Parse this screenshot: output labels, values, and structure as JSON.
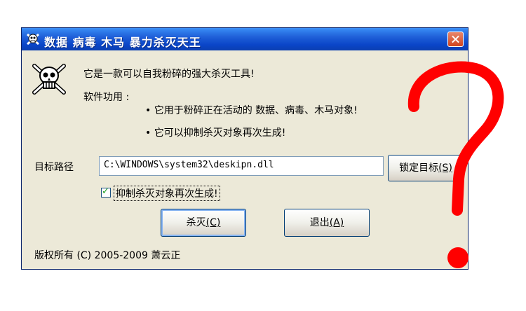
{
  "window": {
    "title": "数据 病毒 木马 暴力杀灭天王",
    "icon": "skull-icon"
  },
  "intro": {
    "headline": "它是一款可以自我粉碎的强大杀灭工具!",
    "features_label": "软件功用 :",
    "bullets": [
      "•  它用于粉碎正在活动的 数据、病毒、木马对象!",
      "•  它可以抑制杀灭对象再次生成!"
    ]
  },
  "target": {
    "label": "目标路径",
    "value": "C:\\WINDOWS\\system32\\deskipn.dll",
    "lock_button": {
      "text": "锁定目标",
      "key": "(S)"
    }
  },
  "suppress": {
    "checked": true,
    "label": "抑制杀灭对象再次生成!"
  },
  "actions": {
    "kill": {
      "text": "杀灭",
      "key": "(C)"
    },
    "exit": {
      "text": "退出",
      "key": "(A)"
    }
  },
  "footer": {
    "copyright": "版权所有 (C) 2005-2009 萧云正"
  },
  "colors": {
    "titlebar": "#0a45c8",
    "dialog_bg": "#ece9d8",
    "annotation_red": "#ff0000"
  }
}
